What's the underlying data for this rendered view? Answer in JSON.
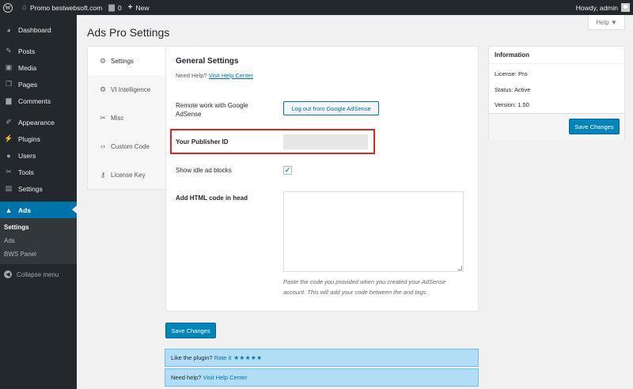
{
  "adminbar": {
    "site_name": "Promo bestwebsoft.com",
    "comments_count": "0",
    "new_label": "New",
    "howdy": "Howdy, admin"
  },
  "sidebar": {
    "items": [
      {
        "label": "Dashboard",
        "icon": "dashboard-icon"
      },
      {
        "label": "Posts",
        "icon": "pin-icon"
      },
      {
        "label": "Media",
        "icon": "media-icon"
      },
      {
        "label": "Pages",
        "icon": "pages-icon"
      },
      {
        "label": "Comments",
        "icon": "comments-icon"
      },
      {
        "label": "Appearance",
        "icon": "brush-icon"
      },
      {
        "label": "Plugins",
        "icon": "plugin-icon"
      },
      {
        "label": "Users",
        "icon": "users-icon"
      },
      {
        "label": "Tools",
        "icon": "wrench-icon"
      },
      {
        "label": "Settings",
        "icon": "settings-icon"
      },
      {
        "label": "Ads",
        "icon": "ads-icon"
      }
    ],
    "submenu": [
      "Settings",
      "Ads",
      "BWS Panel"
    ],
    "collapse_label": "Collapse menu"
  },
  "page": {
    "title": "Ads Pro Settings",
    "help_label": "Help ▼"
  },
  "tabs": [
    {
      "label": "Settings",
      "icon": "gear-icon"
    },
    {
      "label": "VI Intelligence",
      "icon": "gear-icon"
    },
    {
      "label": "Misc",
      "icon": "wrench-icon"
    },
    {
      "label": "Custom Code",
      "icon": "code-icon"
    },
    {
      "label": "License Key",
      "icon": "key-icon"
    }
  ],
  "settings": {
    "heading": "General Settings",
    "need_help": "Need Help?",
    "help_center_link": "Visit Help Center",
    "remote_label_1": "Remote work with Google",
    "remote_label_2": "AdSense",
    "logout_button": "Log out from Google AdSense",
    "publisher_label": "Your Publisher ID",
    "publisher_value": "",
    "idle_label": "Show idle ad blocks",
    "idle_checked": true,
    "html_label": "Add HTML code in head",
    "html_value": "",
    "html_desc_1": "Paste the code you provided when you created your AdSense",
    "html_desc_2": "account. This will add your code between the and tags."
  },
  "info": {
    "title": "Information",
    "license": "License: Pro",
    "status": "Status: Active",
    "version": "Version: 1.50",
    "save_label": "Save Changes"
  },
  "save_label": "Save Changes",
  "notices": {
    "like_text": "Like the plugin?",
    "rate_link": "Rate it",
    "stars": "★★★★★",
    "help_text": "Need help?",
    "help_link": "Visit Help Center"
  },
  "colors": {
    "accent": "#0073aa",
    "highlight": "#e02424",
    "notice_bg": "#b1def6"
  }
}
